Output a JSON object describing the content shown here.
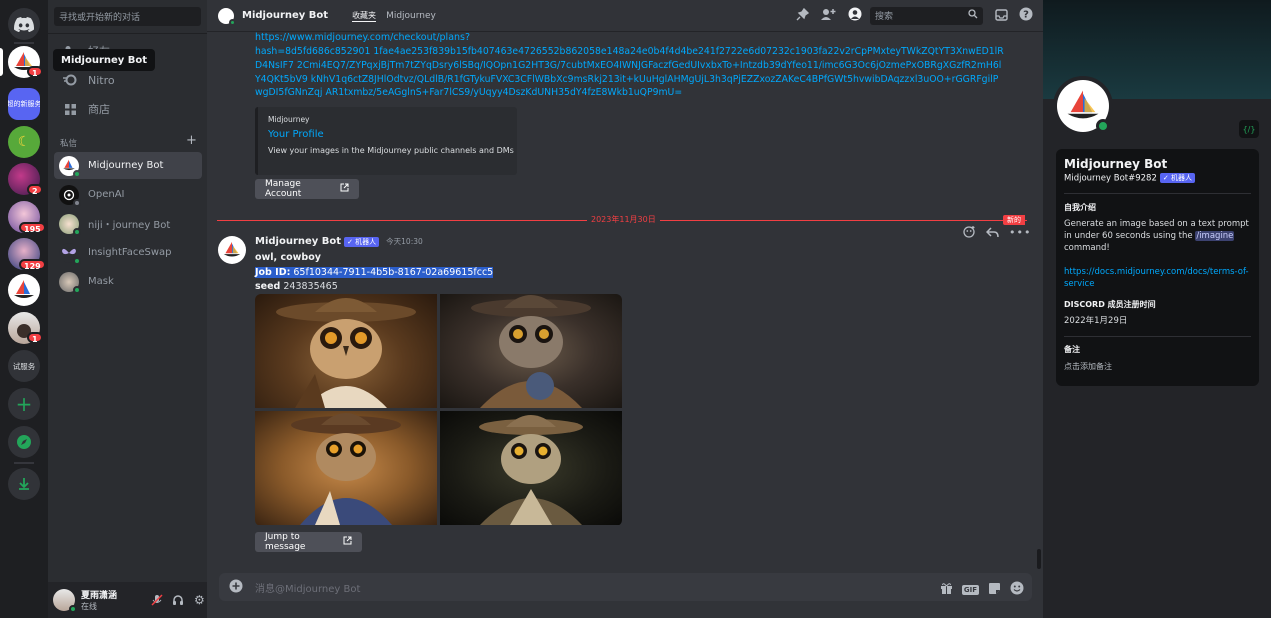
{
  "guild_bar": {
    "tooltip": "Midjourney Bot",
    "items": [
      {
        "name": "discord-home",
        "badge": ""
      },
      {
        "name": "midjourney",
        "badge": "1"
      },
      {
        "name": "server-text",
        "label": "超的新服务",
        "badge": ""
      },
      {
        "name": "banana",
        "badge": ""
      },
      {
        "name": "purple",
        "badge": "2"
      },
      {
        "name": "anime-1",
        "badge": "195"
      },
      {
        "name": "anime-2",
        "badge": "129"
      },
      {
        "name": "midjourney-2",
        "badge": ""
      },
      {
        "name": "person",
        "badge": "1"
      },
      {
        "name": "test-server",
        "label": "试服务",
        "badge": ""
      }
    ]
  },
  "dm_sidebar": {
    "search_placeholder": "寻找或开始新的对话",
    "nav": [
      {
        "label": "好友"
      },
      {
        "label": "Nitro"
      },
      {
        "label": "商店"
      }
    ],
    "section_title": "私信",
    "add_symbol": "+",
    "dms": [
      {
        "label": "Midjourney Bot"
      },
      {
        "label": "OpenAI"
      },
      {
        "label": "niji・journey Bot"
      },
      {
        "label": "InsightFaceSwap"
      },
      {
        "label": "Mask"
      }
    ],
    "user": {
      "name": "夏雨潇涵",
      "status": "在线"
    }
  },
  "topbar": {
    "title": "Midjourney Bot",
    "tab_label": "收藏夹",
    "tab_sub": "Midjourney",
    "search_placeholder": "搜索"
  },
  "chat": {
    "link_line1": "https://www.midjourney.com/checkout/plans?",
    "link_line2": "hash=8d5fd686c852901 1fae4ae253f839b15fb407463e4726552b862058e148a24e0b4f4d4be241f2722e6d07232c1903fa22v2rCpPMxteyTWkZQtYT3XnwED1lRD4NsIF7 2Cmi4EQ7/ZYPqxjBjTm7tZYqDsry6lSBq/IQOpn1G2HT3G/7cubtMxEO4IWNJGFaczfGedUIvxbxTo+Intzdb39dYfeo11/imc6G3Oc6jOzmePxOBRgXGzfR2mH6lY4QKt5bV9 kNhV1q6ctZ8JHlOdtvz/QLdlB/R1fGTykuFVXC3CFlWBbXc9msRkj213it+kUuHglAHMgUjL3h3qPjEZZxozZAKeC4BPfGWt5hvwibDAqzzxl3uOO+rGGRFgilPwgDI5fGNnZqj AR1txmbz/5eAGglnS+Far7lCS9/yUqyy4DszKdUNH35dY4fzE8Wkb1uQP9mU=",
    "embed": {
      "provider": "Midjourney",
      "title": "Your Profile",
      "desc": "View your images in the Midjourney public channels and DMs"
    },
    "manage_button": "Manage Account",
    "date_divider": "2023年11月30日",
    "new_tag": "新的",
    "message": {
      "author": "Midjourney Bot",
      "bot_tag": "✓ 机器人",
      "time": "今天10:30",
      "line1": "owl, cowboy",
      "jobid_label": "Job ID:",
      "jobid_value": "65f10344-7911-4b5b-8167-02a69615fcc5",
      "seed_label": "seed",
      "seed_value": "243835465"
    },
    "jump_button": "Jump to message"
  },
  "input": {
    "placeholder": "消息@Midjourney Bot",
    "gif": "GIF"
  },
  "profile": {
    "code_icon": "{/}",
    "name": "Midjourney Bot",
    "tag": "Midjourney Bot#9282",
    "bot_tag": "✓ 机器人",
    "about_title": "自我介绍",
    "about_pre": "Generate an image based on a text prompt in under 60 seconds using the ",
    "about_cmd": "/imagine",
    "about_post": " command!",
    "link": "https://docs.midjourney.com/docs/terms-of-service",
    "member_title": "DISCORD 成员注册时间",
    "member_date": "2022年1月29日",
    "note_title": "备注",
    "note_placeholder": "点击添加备注"
  },
  "colors": {
    "accent": "#5865f2",
    "link": "#00a8fc",
    "online": "#23a55a",
    "danger": "#f23f43"
  }
}
